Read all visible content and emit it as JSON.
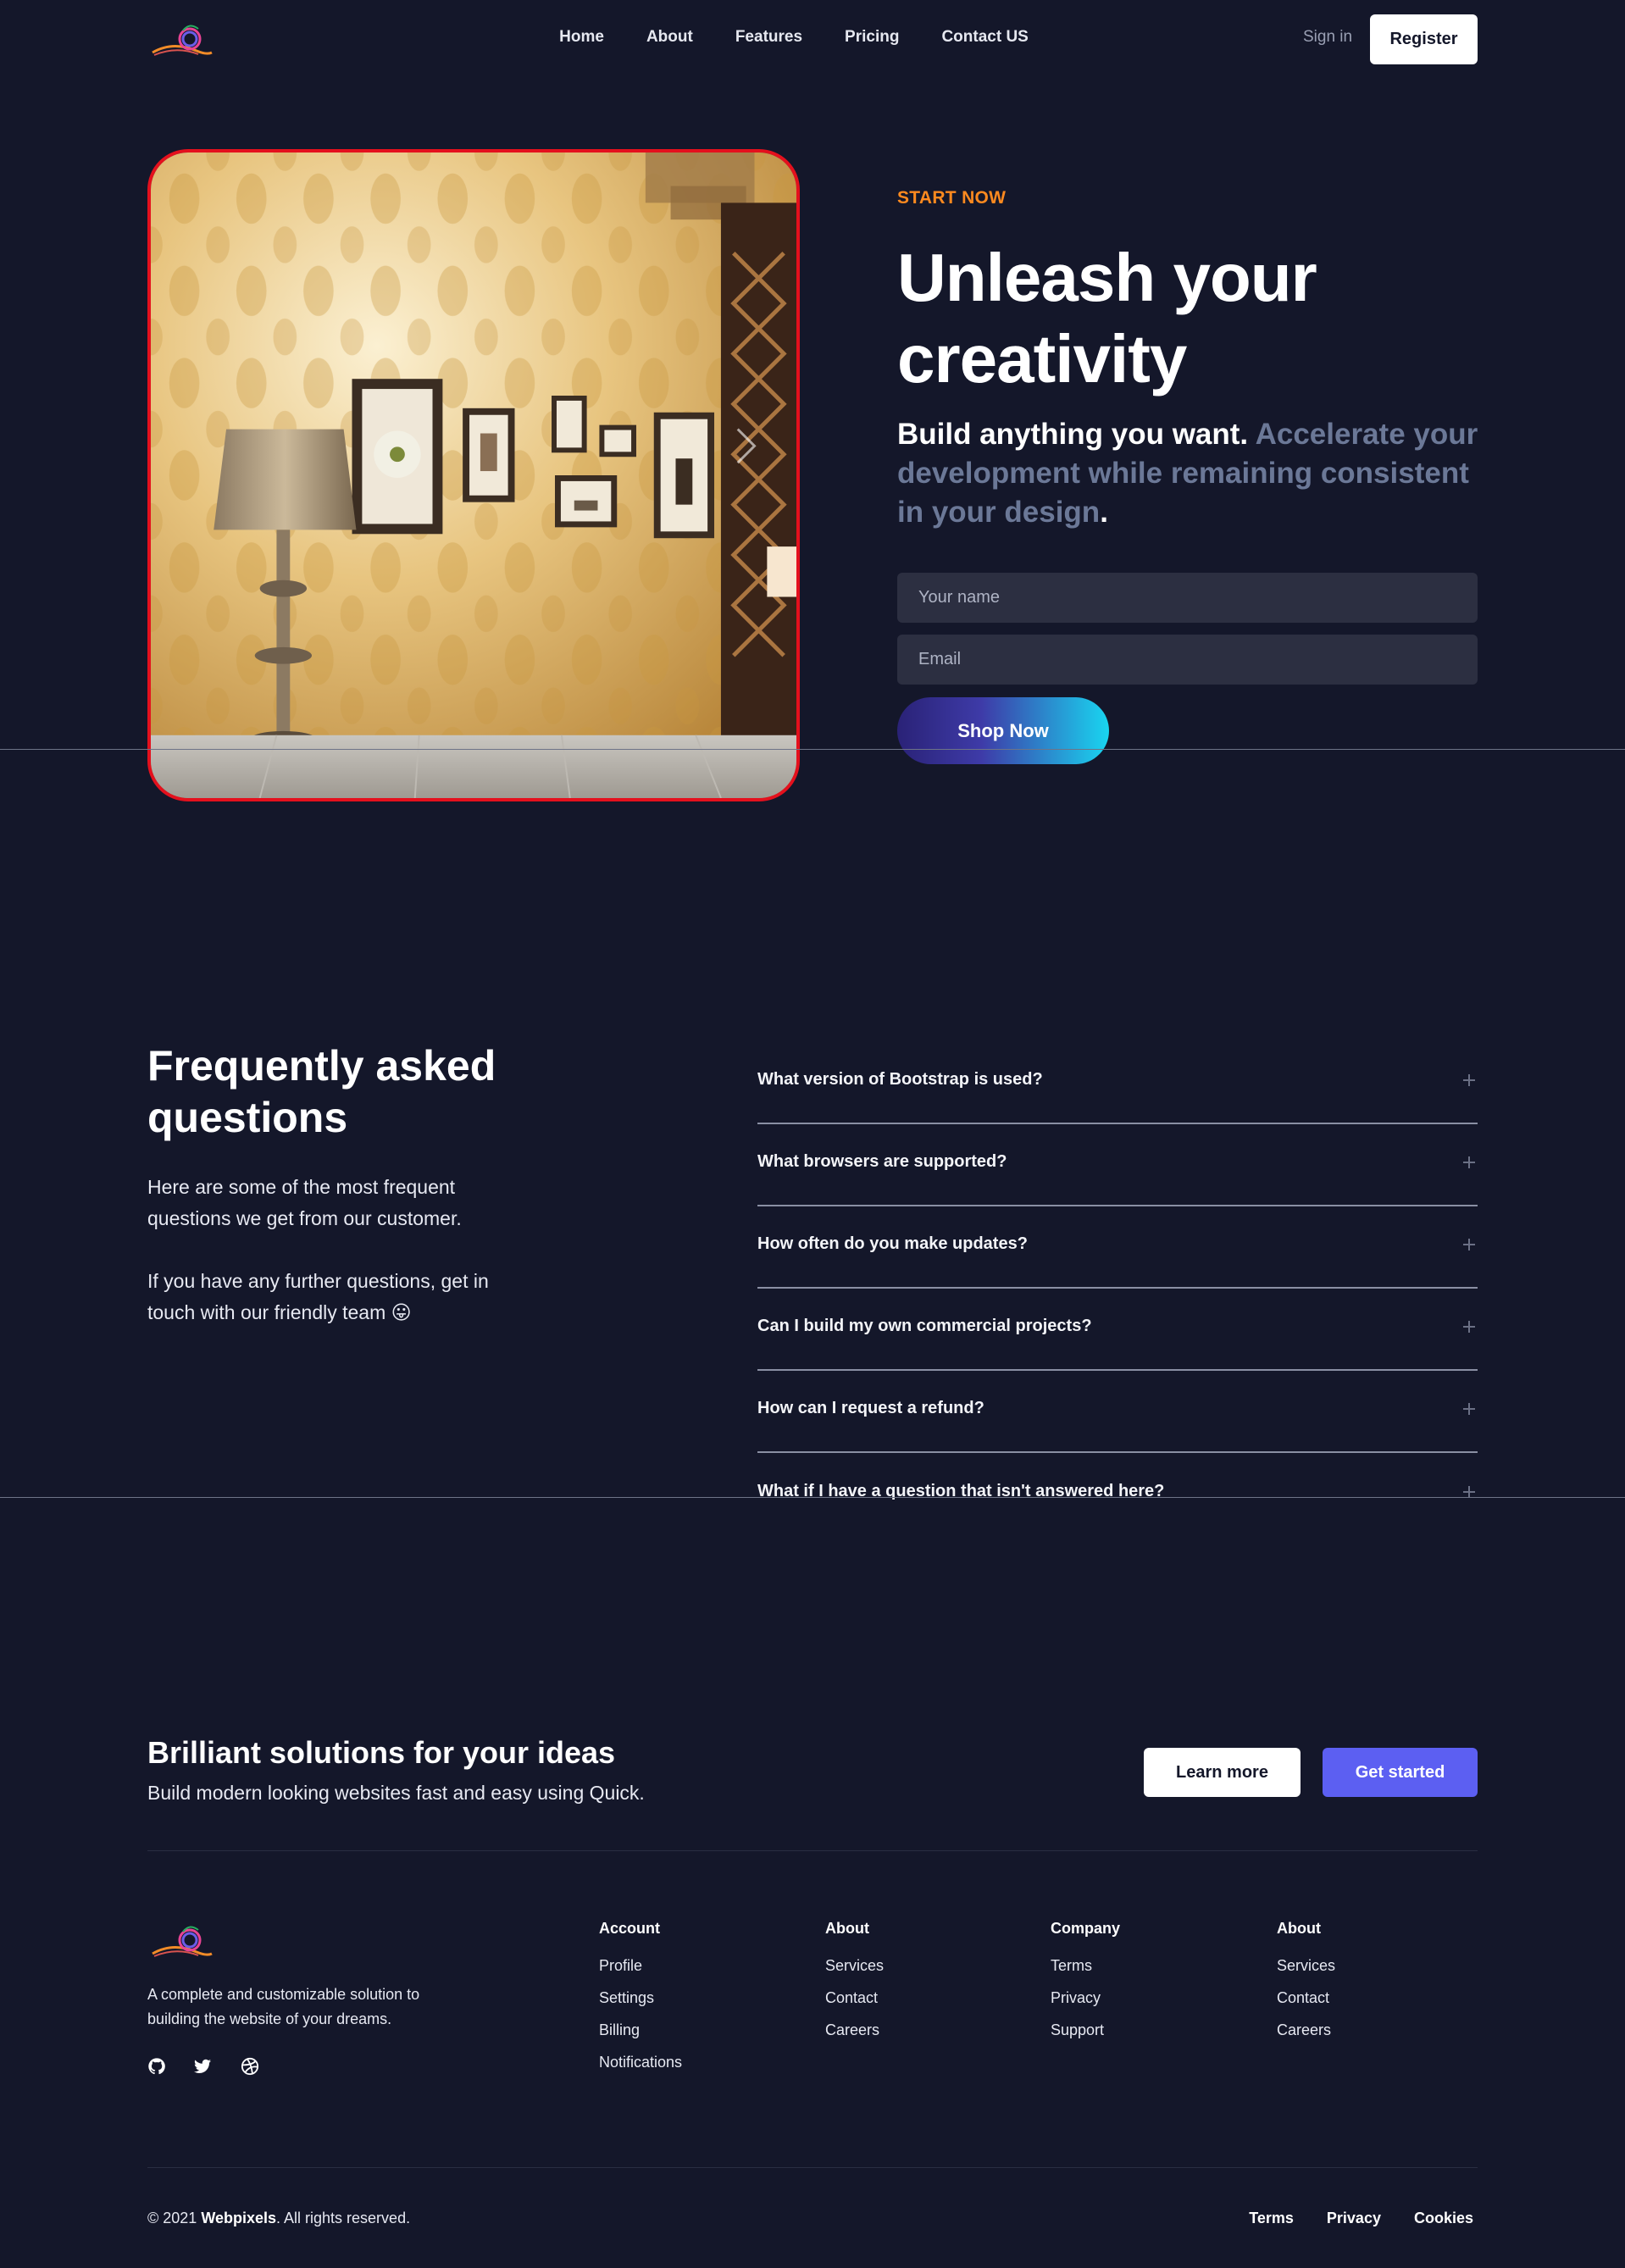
{
  "nav": {
    "links": [
      "Home",
      "About",
      "Features",
      "Pricing",
      "Contact US"
    ],
    "signin": "Sign in",
    "register": "Register"
  },
  "hero": {
    "eyebrow": "START NOW",
    "title_line1": "Unleash your",
    "title_line2": "creativity",
    "subtitle_white": "Build anything you want.",
    "subtitle_muted": "Accelerate your development while remaining consistent in your design",
    "subtitle_end": ".",
    "name_placeholder": "Your name",
    "email_placeholder": "Email",
    "button": "Shop Now"
  },
  "faq": {
    "title": "Frequently asked questions",
    "intro1": "Here are some of the most frequent questions we get from our customer.",
    "intro2": "If you have any further questions, get in touch with our friendly team 😛",
    "questions": [
      "What version of Bootstrap is used?",
      "What browsers are supported?",
      "How often do you make updates?",
      "Can I build my own commercial projects?",
      "How can I request a refund?",
      "What if I have a question that isn't answered here?"
    ]
  },
  "cta": {
    "title": "Brilliant solutions for your ideas",
    "subtitle": "Build modern looking websites fast and easy using Quick.",
    "learn": "Learn more",
    "start": "Get started"
  },
  "footer": {
    "description": "A complete and customizable solution to building the website of your dreams.",
    "columns": [
      {
        "title": "Account",
        "links": [
          "Profile",
          "Settings",
          "Billing",
          "Notifications"
        ]
      },
      {
        "title": "About",
        "links": [
          "Services",
          "Contact",
          "Careers"
        ]
      },
      {
        "title": "Company",
        "links": [
          "Terms",
          "Privacy",
          "Support"
        ]
      },
      {
        "title": "About",
        "links": [
          "Services",
          "Contact",
          "Careers"
        ]
      }
    ],
    "copyright_prefix": "© 2021 ",
    "brand": "Webpixels",
    "copyright_suffix": ". All rights reserved.",
    "bottom_links": [
      "Terms",
      "Privacy",
      "Cookies"
    ],
    "social_icons": [
      "github-icon",
      "twitter-icon",
      "dribbble-icon"
    ]
  }
}
